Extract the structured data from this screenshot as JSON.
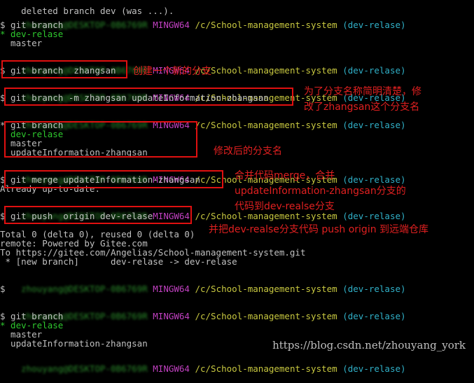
{
  "terminal": {
    "top_fragment": "deleted branch dev (was ...).",
    "host_blur": "zhouyang@DESKTOP-0B6769R",
    "app": "MINGW64",
    "path": "/c/School-management-system",
    "branch": "(dev-relase)",
    "cmd_branch": "$ git branch",
    "branch_list_1": [
      "* dev-relase",
      "  master"
    ],
    "cmd_create": "$ git branch  zhangsan",
    "cmd_rename": "$ git branch -m zhangsan updateInformation-zhangsan",
    "branch_list_2": [
      "* git branch",
      "  dev-relase",
      "  master",
      "  updateInformation-zhangsan"
    ],
    "cmd_merge": "$ git merge updateInformation-zhangsan",
    "merge_output": "Already up-to-date.",
    "cmd_push": "$ git push  origin dev-relase",
    "push_output": [
      "Total 0 (delta 0), reused 0 (delta 0)",
      "remote: Powered by Gitee.com",
      "To https://gitee.com/Angelias/School-management-system.git",
      " * [new branch]      dev-relase -> dev-relase"
    ],
    "empty_prompt": "$",
    "branch_list_3": [
      "* dev-relase",
      "  master",
      "  updateInformation-zhangsan"
    ]
  },
  "annotations": {
    "create": "创建一个新的分支",
    "rename": "为了分支名称简明清楚，修\n改了zhangsan这个分支名",
    "modified": "修改后的分支名",
    "merge": "合并代码merge，合并\nupdateInformation-zhangsan分支的\n代码到dev-realse分支",
    "push": "并把dev-realse分支代码 push origin 到远端仓库"
  },
  "watermark": "https://blog.csdn.net/zhouyang_york",
  "colors": {
    "background": "#000000",
    "prompt_green": "#2ec82e",
    "mingw_purple": "#c040c0",
    "path_yellow": "#c8c840",
    "branch_cyan": "#30b0c8",
    "annotation_red": "#e02020"
  }
}
